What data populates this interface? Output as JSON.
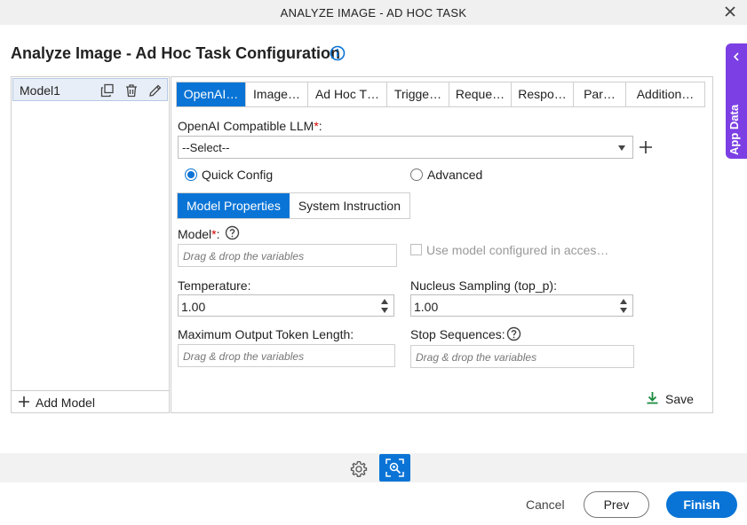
{
  "window": {
    "title": "ANALYZE IMAGE - AD HOC TASK"
  },
  "page": {
    "title": "Analyze Image - Ad Hoc Task Configuration"
  },
  "side_panel": {
    "label": "App Data"
  },
  "models": {
    "items": [
      {
        "name": "Model1"
      }
    ],
    "add_label": "Add Model"
  },
  "tabs": [
    {
      "label": "OpenAI…",
      "active": true
    },
    {
      "label": "Image…"
    },
    {
      "label": "Ad Hoc T…"
    },
    {
      "label": "Trigge…"
    },
    {
      "label": "Reque…"
    },
    {
      "label": "Respo…"
    },
    {
      "label": "Par…"
    },
    {
      "label": "Addition…"
    }
  ],
  "llm": {
    "label": "OpenAI Compatible LLM",
    "required_mark": "*",
    "colon": ":",
    "selected": "--Select--"
  },
  "config_mode": {
    "quick": "Quick Config",
    "advanced": "Advanced",
    "selected": "quick"
  },
  "subtabs": [
    {
      "label": "Model Properties",
      "active": true
    },
    {
      "label": "System Instruction"
    }
  ],
  "fields": {
    "model": {
      "label": "Model",
      "required_mark": "*",
      "colon": ":",
      "placeholder": "Drag & drop the variables"
    },
    "use_model_checkbox": "Use model configured in acces…",
    "temperature": {
      "label": "Temperature:",
      "value": "1.00"
    },
    "top_p": {
      "label": "Nucleus Sampling (top_p):",
      "value": "1.00"
    },
    "max_tokens": {
      "label": "Maximum Output Token Length:",
      "placeholder": "Drag & drop the variables"
    },
    "stop_sequences": {
      "label": "Stop Sequences:",
      "placeholder": "Drag & drop the variables"
    }
  },
  "save_label": "Save",
  "footer": {
    "cancel": "Cancel",
    "prev": "Prev",
    "finish": "Finish"
  },
  "colors": {
    "primary": "#0a74d6",
    "side_panel": "#7b3fe4",
    "required": "#d20000",
    "save_icon": "#1a8a3c"
  }
}
